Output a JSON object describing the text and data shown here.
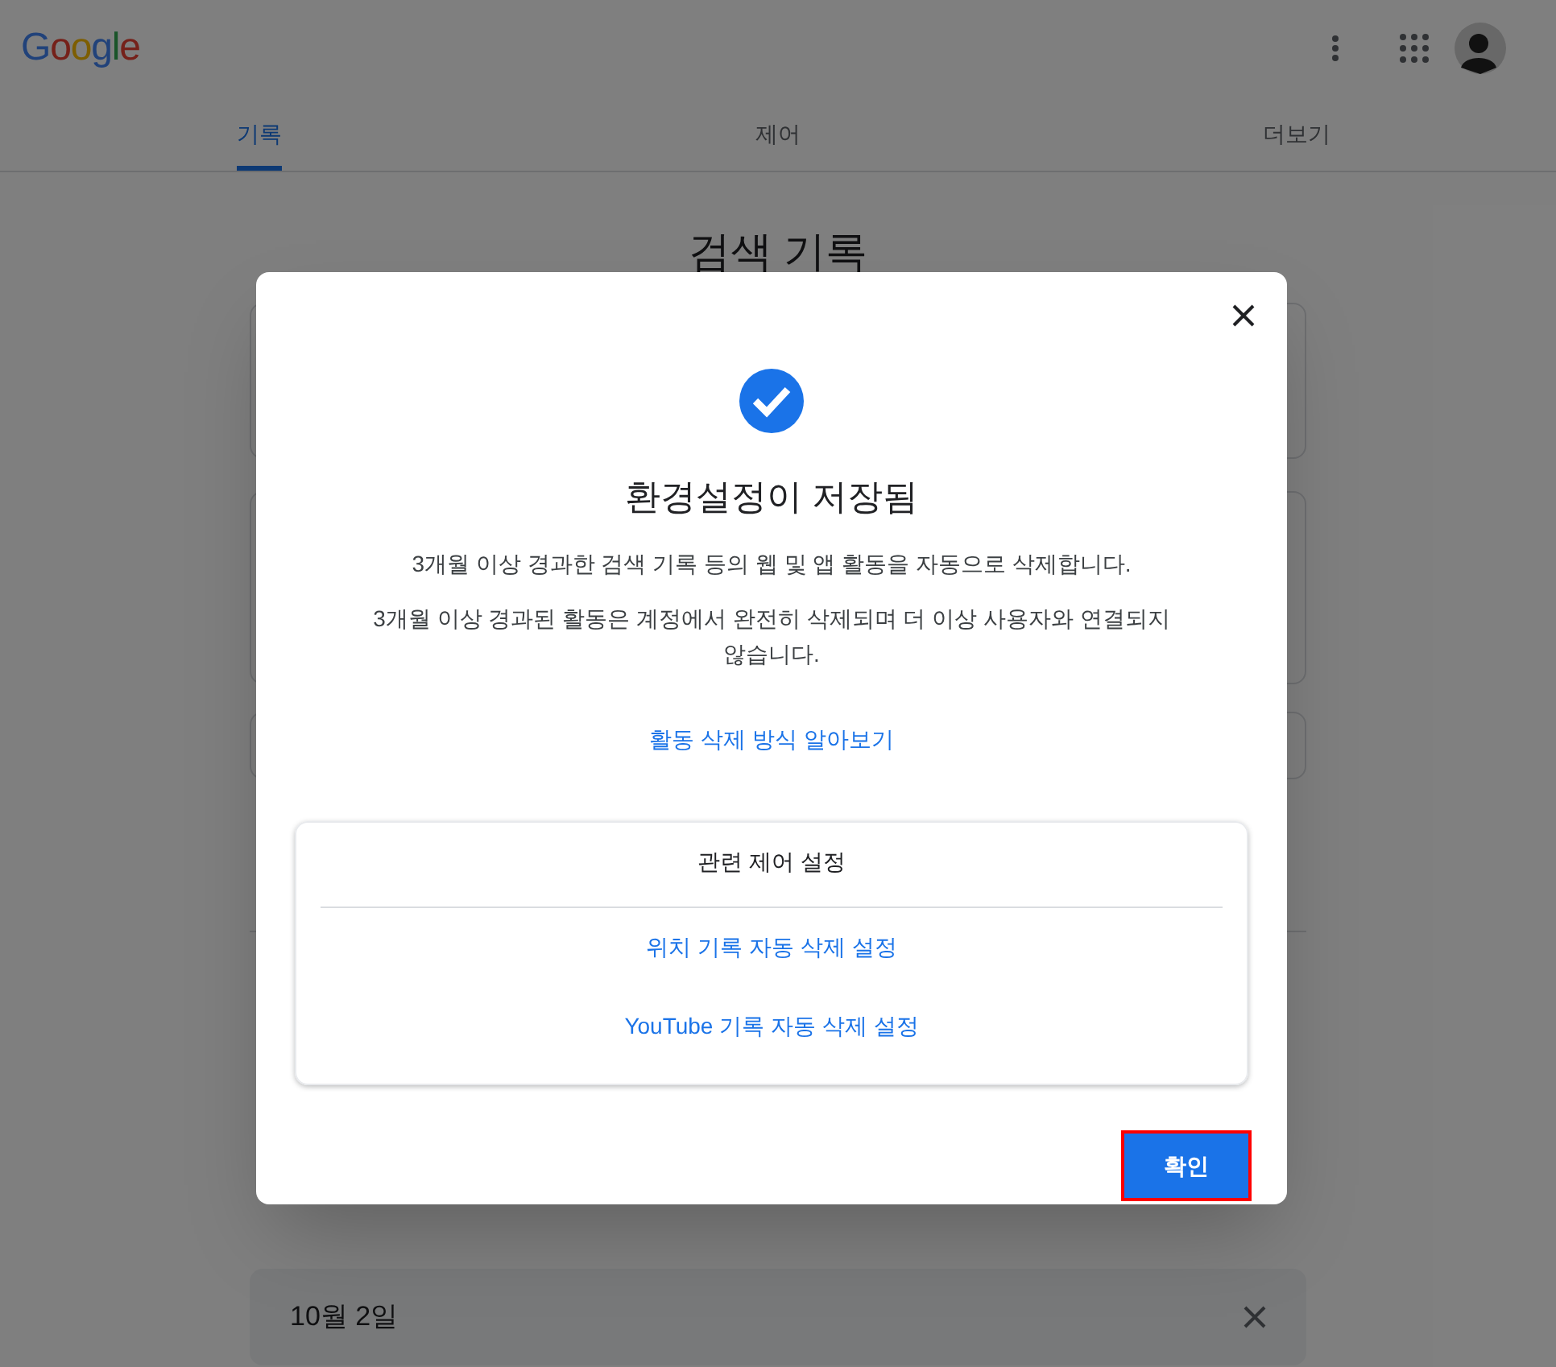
{
  "header": {
    "logo": "Google"
  },
  "tabs": [
    {
      "label": "기록",
      "selected": true
    },
    {
      "label": "제어",
      "selected": false
    },
    {
      "label": "더보기",
      "selected": false
    }
  ],
  "page": {
    "title": "검색 기록",
    "date_card": {
      "date": "10월 2일"
    }
  },
  "dialog": {
    "title": "환경설정이 저장됨",
    "messages": [
      "3개월 이상 경과한 검색 기록 등의 웹 및 앱 활동을 자동으로 삭제합니다.",
      "3개월 이상 경과된 활동은 계정에서 완전히 삭제되며 더 이상 사용자와 연결되지 않습니다."
    ],
    "learn_more_link": "활동 삭제 방식 알아보기",
    "related": {
      "heading": "관련 제어 설정",
      "links": [
        "위치 기록 자동 삭제 설정",
        "YouTube 기록 자동 삭제 설정"
      ]
    },
    "confirm_button": {
      "label": "확인",
      "highlighted": true
    }
  }
}
